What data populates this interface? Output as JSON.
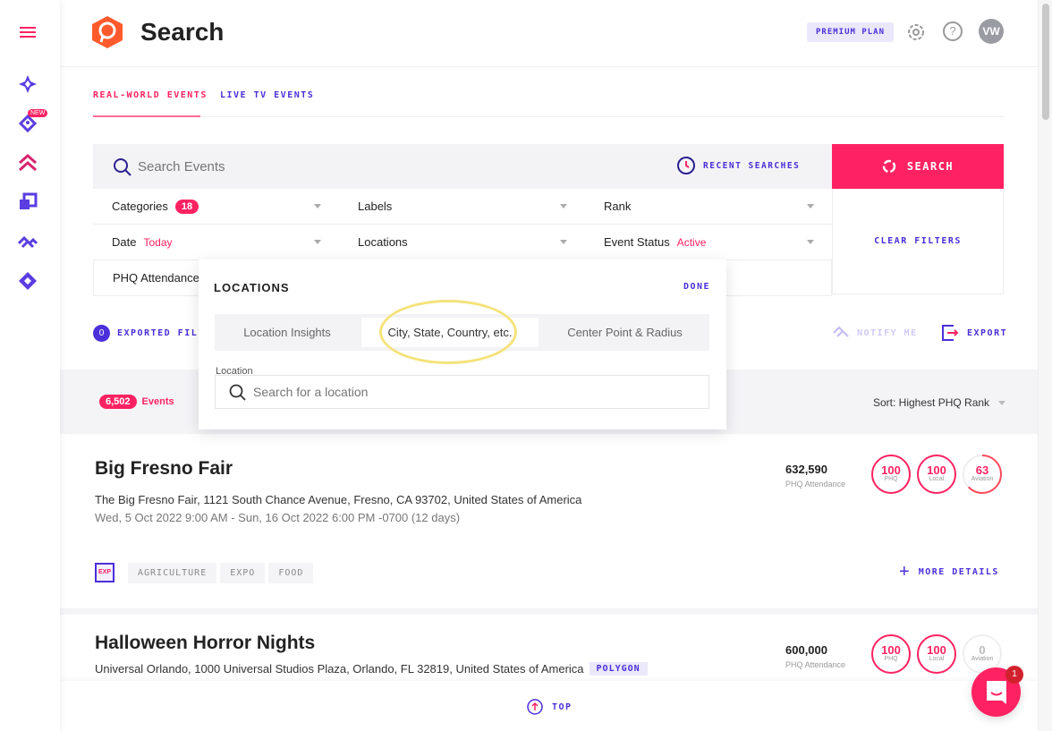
{
  "header": {
    "title": "Search",
    "plan": "PREMIUM PLAN",
    "avatar": "VW",
    "icons": [
      "settings-icon",
      "help-icon"
    ]
  },
  "sidebar": {
    "new_badge": "NEW",
    "items": [
      "menu",
      "explore",
      "insights",
      "rank",
      "data-exporter",
      "trends",
      "integrations"
    ]
  },
  "tabs": [
    {
      "label": "REAL-WORLD EVENTS",
      "active": true
    },
    {
      "label": "LIVE TV EVENTS",
      "active": false
    }
  ],
  "search": {
    "placeholder": "Search Events",
    "recent": "RECENT SEARCHES",
    "button": "SEARCH",
    "clear": "CLEAR FILTERS"
  },
  "filters": {
    "categories": "Categories",
    "categories_count": "18",
    "labels": "Labels",
    "rank": "Rank",
    "date": "Date",
    "date_value": "Today",
    "locations": "Locations",
    "event_status": "Event Status",
    "event_status_value": "Active",
    "attendance": "PHQ Attendance"
  },
  "locations_popup": {
    "title": "LOCATIONS",
    "done": "DONE",
    "tabs": [
      "Location Insights",
      "City, State, Country, etc.",
      "Center Point & Radius"
    ],
    "active_tab": 1,
    "field_label": "Location",
    "placeholder": "Search for a location"
  },
  "actions": {
    "exported_count": "0",
    "exported_label": "EXPORTED FILE",
    "notify": "NOTIFY ME",
    "export": "EXPORT"
  },
  "results": {
    "count": "6,502",
    "count_label": "Events",
    "sort": "Sort: Highest PHQ Rank"
  },
  "events": [
    {
      "title": "Big Fresno Fair",
      "address": "The Big Fresno Fair, 1121 South Chance Avenue, Fresno, CA 93702, United States of America",
      "dates": "Wed, 5 Oct 2022 9:00 AM - Sun, 16 Oct 2022 6:00 PM -0700 (12 days)",
      "attendance": "632,590",
      "attendance_label": "PHQ Attendance",
      "ranks": [
        {
          "value": "100",
          "label": "PHQ",
          "fraction": 1
        },
        {
          "value": "100",
          "label": "Local",
          "fraction": 1
        },
        {
          "value": "63",
          "label": "Aviation",
          "fraction": 0.63
        }
      ],
      "category_icon": "EXP",
      "tags": [
        "AGRICULTURE",
        "EXPO",
        "FOOD"
      ],
      "more": "MORE DETAILS"
    },
    {
      "title": "Halloween Horror Nights",
      "address": "Universal Orlando, 1000 Universal Studios Plaza, Orlando, FL 32819, United States of America",
      "badge": "POLYGON",
      "attendance": "600,000",
      "attendance_label": "PHQ Attendance",
      "ranks": [
        {
          "value": "100",
          "label": "PHQ",
          "fraction": 1
        },
        {
          "value": "100",
          "label": "Local",
          "fraction": 1
        },
        {
          "value": "0",
          "label": "Aviation",
          "fraction": 0
        }
      ]
    }
  ],
  "footer": {
    "top": "TOP",
    "chat_count": "1"
  },
  "colors": {
    "accent": "#ff2262",
    "primary": "#4b2fd9",
    "highlight": "#f5e27a"
  }
}
